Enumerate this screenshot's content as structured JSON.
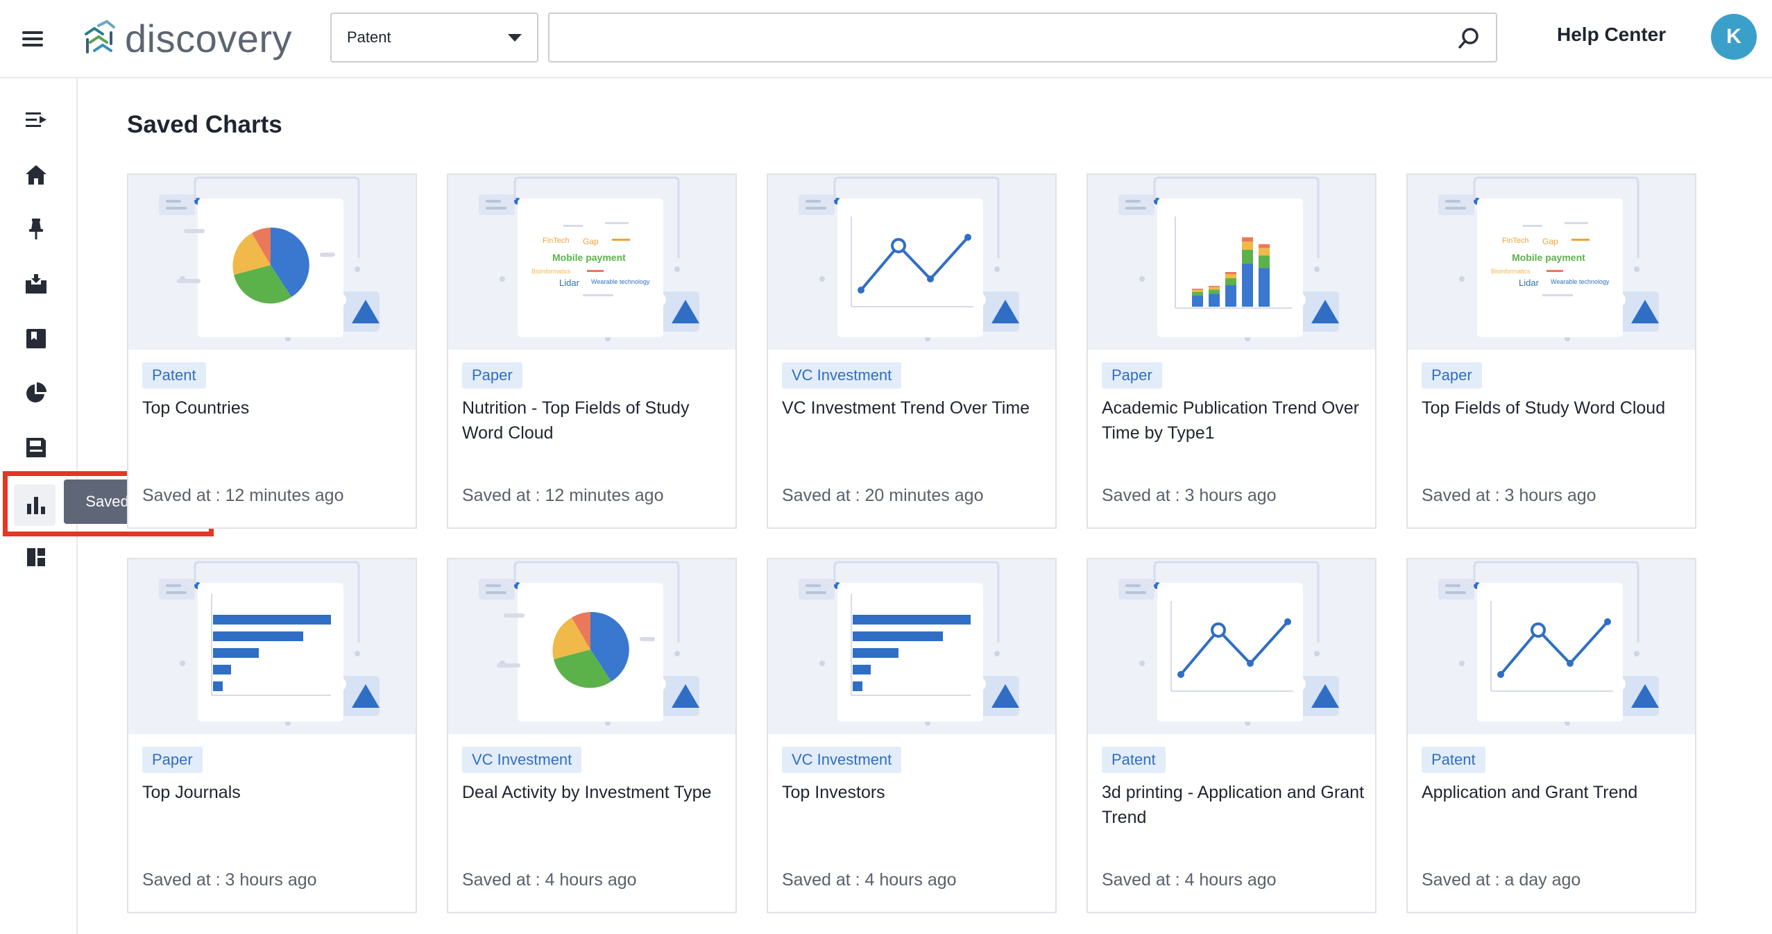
{
  "app": {
    "logo_text": "discovery",
    "type_select": "Patent",
    "search": {
      "value": "",
      "placeholder": ""
    },
    "help_label": "Help Center",
    "avatar_initial": "K"
  },
  "sidebar": {
    "tooltip": "Saved Charts",
    "items": [
      {
        "icon": "expand-icon"
      },
      {
        "icon": "home-icon"
      },
      {
        "icon": "pin-icon"
      },
      {
        "icon": "inbox-icon"
      },
      {
        "icon": "bookmark-icon"
      },
      {
        "icon": "pie-chart-icon"
      },
      {
        "icon": "save-icon"
      },
      {
        "icon": "bar-chart-icon",
        "active": true
      },
      {
        "icon": "dashboard-icon"
      }
    ]
  },
  "page": {
    "title": "Saved Charts",
    "saved_prefix": "Saved at :"
  },
  "cards": [
    {
      "tag": "Patent",
      "title": "Top Countries",
      "saved": "12 minutes ago",
      "thumb": "pie"
    },
    {
      "tag": "Paper",
      "title": "Nutrition - Top Fields of Study Word Cloud",
      "saved": "12 minutes ago",
      "thumb": "wordcloud"
    },
    {
      "tag": "VC Investment",
      "title": "VC Investment Trend Over Time",
      "saved": "20 minutes ago",
      "thumb": "line"
    },
    {
      "tag": "Paper",
      "title": "Academic Publication Trend Over Time by Type1",
      "saved": "3 hours ago",
      "thumb": "stacked"
    },
    {
      "tag": "Paper",
      "title": "Top Fields of Study Word Cloud",
      "saved": "3 hours ago",
      "thumb": "wordcloud"
    },
    {
      "tag": "Paper",
      "title": "Top Journals",
      "saved": "3 hours ago",
      "thumb": "hbar"
    },
    {
      "tag": "VC Investment",
      "title": "Deal Activity by Investment Type",
      "saved": "4 hours ago",
      "thumb": "pie"
    },
    {
      "tag": "VC Investment",
      "title": "Top Investors",
      "saved": "4 hours ago",
      "thumb": "hbar"
    },
    {
      "tag": "Patent",
      "title": "3d printing - Application and Grant Trend",
      "saved": "4 hours ago",
      "thumb": "line"
    },
    {
      "tag": "Patent",
      "title": "Application and Grant Trend",
      "saved": "a day ago",
      "thumb": "line"
    }
  ],
  "wordcloud_words": [
    "FinTech",
    "Gap",
    "Mobile payment",
    "Bioinformatics",
    "Lidar",
    "Wearable technology"
  ],
  "colors": {
    "accent": "#2f6ec4",
    "badge_bg": "#e3edf9",
    "avatar": "#3aa0c9",
    "highlight_border": "#e53524",
    "pie": [
      "#3a78cf",
      "#5cb24a",
      "#f0b94a",
      "#e9795a"
    ]
  }
}
